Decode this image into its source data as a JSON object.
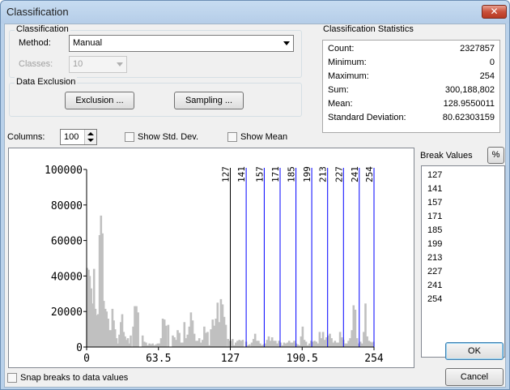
{
  "window": {
    "title": "Classification",
    "close_glyph": "✕"
  },
  "classification": {
    "group_label": "Classification",
    "method_label": "Method:",
    "method_value": "Manual",
    "classes_label": "Classes:",
    "classes_value": "10"
  },
  "exclusion": {
    "group_label": "Data Exclusion",
    "exclusion_button": "Exclusion ...",
    "sampling_button": "Sampling ..."
  },
  "stats": {
    "group_label": "Classification Statistics",
    "rows": [
      {
        "key": "Count:",
        "value": "2327857"
      },
      {
        "key": "Minimum:",
        "value": "0"
      },
      {
        "key": "Maximum:",
        "value": "254"
      },
      {
        "key": "Sum:",
        "value": "300,188,802"
      },
      {
        "key": "Mean:",
        "value": "128.9550011"
      },
      {
        "key": "Standard Deviation:",
        "value": "80.62303159"
      }
    ]
  },
  "controls": {
    "columns_label": "Columns:",
    "columns_value": "100",
    "show_std_dev": "Show Std. Dev.",
    "show_mean": "Show Mean",
    "snap_breaks": "Snap breaks to data values"
  },
  "break_values": {
    "label": "Break Values",
    "percent_button": "%",
    "values": [
      "127",
      "141",
      "157",
      "171",
      "185",
      "199",
      "213",
      "227",
      "241",
      "254"
    ]
  },
  "buttons": {
    "ok": "OK",
    "cancel": "Cancel"
  },
  "colors": {
    "bar": "#c0c0c0",
    "break_line": "#0000ff",
    "break_line_first": "#000000"
  },
  "chart_data": {
    "type": "bar",
    "xlim": [
      0,
      254
    ],
    "ylim": [
      0,
      100000
    ],
    "x_ticks": [
      "0",
      "63.5",
      "127",
      "190.5",
      "254"
    ],
    "x_tick_values": [
      0,
      63.5,
      127,
      190.5,
      254
    ],
    "y_ticks": [
      "0",
      "20000",
      "40000",
      "60000",
      "80000",
      "100000"
    ],
    "y_tick_values": [
      0,
      20000,
      40000,
      60000,
      80000,
      100000
    ],
    "breaks": [
      127,
      141,
      157,
      171,
      185,
      199,
      213,
      227,
      241,
      254
    ],
    "break_labels": [
      "127",
      "141",
      "157",
      "171",
      "185",
      "199",
      "213",
      "227",
      "241",
      "254"
    ],
    "x": [
      0.4,
      1.7,
      2.8,
      4.1,
      5.3,
      6.6,
      7.8,
      9.0,
      10.2,
      11.5,
      12.7,
      14.0,
      15.2,
      16.5,
      17.7,
      19.0,
      20.2,
      21.5,
      22.8,
      24.0,
      25.2,
      26.5,
      27.7,
      29.0,
      30.3,
      31.5,
      32.8,
      34.0,
      35.3,
      36.5,
      37.8,
      39.0,
      41.2,
      42.6,
      44.0,
      45.5,
      49.5,
      51.0,
      52.5,
      54.0,
      55.5,
      57.0,
      58.4,
      59.9,
      61.4,
      62.9,
      64.3,
      65.8,
      67.3,
      68.8,
      70.2,
      72.2,
      76.2,
      77.6,
      79.0,
      80.5,
      82.0,
      83.4,
      84.9,
      86.4,
      87.8,
      89.3,
      90.8,
      92.2,
      93.7,
      95.2,
      96.6,
      98.1,
      99.6,
      101.0,
      102.5,
      104.0,
      105.4,
      107.0,
      108.4,
      109.9,
      111.4,
      112.8,
      114.3,
      115.8,
      117.2,
      118.7,
      120.2,
      121.6,
      123.1,
      125.0,
      126.0,
      127.5,
      129.0,
      130.4,
      131.9,
      133.4,
      135.0,
      136.6,
      138.0,
      141.0,
      142.5,
      144.0,
      146.0,
      147.5,
      149.0,
      150.5,
      152.0,
      153.5,
      155.0,
      156.5,
      158.0,
      159.5,
      161.0,
      162.5,
      164.0,
      165.5,
      167.0,
      168.5,
      170.0,
      171.5,
      173.0,
      174.5,
      176.0,
      177.5,
      179.0,
      180.5,
      182.0,
      183.5,
      185.0,
      186.5,
      188.0,
      189.5,
      191.0,
      192.5,
      194.0,
      195.5,
      197.0,
      198.5,
      200.0,
      201.5,
      203.0,
      204.5,
      206.0,
      207.5,
      209.0,
      210.5,
      212.0,
      213.5,
      215.0,
      216.5,
      218.0,
      219.5,
      221.0,
      222.5,
      224.0,
      225.5,
      227.0,
      228.5,
      230.0,
      231.5,
      233.0,
      234.5,
      236.0,
      237.5,
      239.0,
      240.5,
      242.0,
      243.5,
      245.0,
      246.5,
      248.0,
      249.5,
      251.0,
      252.5,
      253.6
    ],
    "values": [
      44500,
      43500,
      40000,
      33000,
      24500,
      44000,
      21500,
      18000,
      18500,
      63000,
      74000,
      64000,
      26000,
      21500,
      20000,
      16000,
      9500,
      9500,
      21500,
      15000,
      10000,
      5000,
      2000,
      7000,
      14000,
      18500,
      8500,
      6000,
      4000,
      5000,
      2000,
      6500,
      11500,
      23000,
      23000,
      19500,
      6500,
      3000,
      2500,
      1000,
      2000,
      1500,
      2000,
      1000,
      1500,
      2000,
      2000,
      5000,
      16000,
      15500,
      12000,
      12500,
      6500,
      5500,
      4000,
      9500,
      8000,
      2500,
      2500,
      14000,
      5000,
      7000,
      11500,
      19500,
      15000,
      7500,
      3500,
      3500,
      5000,
      2500,
      4000,
      11500,
      8000,
      8500,
      1000,
      10000,
      15500,
      12000,
      16000,
      25000,
      14000,
      27000,
      24000,
      17000,
      12500,
      4500,
      3500,
      3500,
      4500,
      1000,
      2500,
      3500,
      4000,
      3500,
      4000,
      3000,
      1000,
      1500,
      2500,
      4500,
      7500,
      3500,
      3500,
      2000,
      1000,
      1500,
      2000,
      4000,
      6000,
      3500,
      5500,
      3500,
      3500,
      2000,
      3500,
      2500,
      1000,
      2500,
      2000,
      2500,
      3500,
      2500,
      2500,
      3500,
      2000,
      1500,
      1000,
      6000,
      11500,
      4000,
      3000,
      1000,
      2000,
      3500,
      3000,
      3500,
      3000,
      2000,
      8500,
      5000,
      8500,
      4000,
      5500,
      6500,
      7500,
      5000,
      2500,
      3500,
      2500,
      2500,
      8500,
      5500,
      4000,
      2000,
      2000,
      3500,
      5000,
      9500,
      23500,
      21000,
      5000,
      2000,
      3000,
      2000,
      8500,
      24500,
      6000,
      3500,
      3000,
      2500,
      3000,
      4000,
      6000,
      4500,
      3500,
      2500,
      3000,
      3500
    ]
  }
}
